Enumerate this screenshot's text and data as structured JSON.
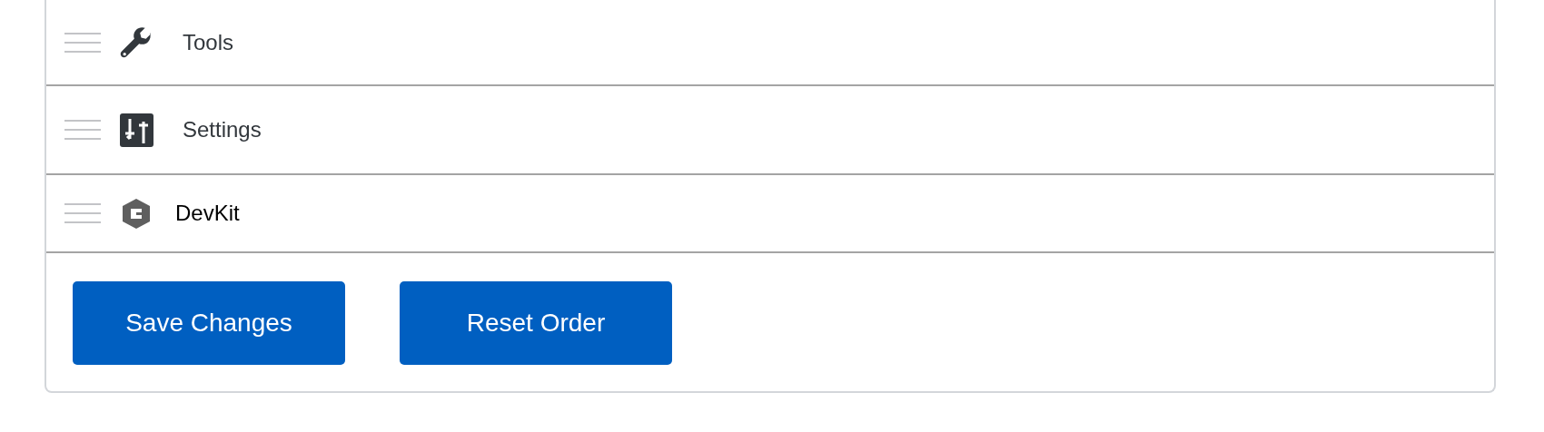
{
  "items": [
    {
      "label": "Tools",
      "kind": "wrench"
    },
    {
      "label": "Settings",
      "kind": "sliders"
    },
    {
      "label": "DevKit",
      "kind": "devkit"
    }
  ],
  "buttons": [
    "Save Changes",
    "Reset Order"
  ]
}
